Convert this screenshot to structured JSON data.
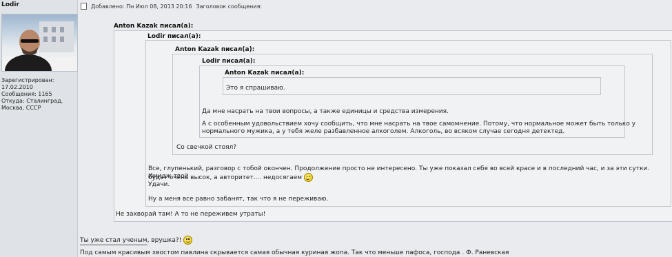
{
  "author": {
    "name": "Lodir",
    "profile_lines": [
      "Зарегистрирован:",
      "17.02.2010",
      "Сообщения: 1165",
      "Откуда: Сталинград,",
      "Москва, СССР"
    ]
  },
  "post": {
    "added": "Добавлено: Пн Июл 08, 2013 20:16",
    "subject_label": "Заголовок сообщения:"
  },
  "quotes": {
    "q1_head": "Anton Kazak писал(а):",
    "q2_head": "Lodir писал(а):",
    "q3_head": "Anton Kazak писал(а):",
    "q4_head": "Lodir писал(а):",
    "q5_head": "Anton Kazak писал(а):",
    "q5_text": "Это я спрашиваю.",
    "q4_text1": "Да мне насрать на твои вопросы, а также единицы и средства измерения.",
    "q4_text2a": "А с особенным удовольствием хочу сообщить, что мне насрать на твое самомнение. Потому, что нормальное может быть только у",
    "q4_text2b": "нормального мужика, а у тебя желе разбавленное алкоголем. Алкоголь, во всяком случае сегодня детектед.",
    "q3_text": "Со свечкой стоял?",
    "q2_text1a": "Все, глупенький, разговор с тобой окончен. Продолжение просто не интересено. Ты уже показал себя во всей красе и в последний час, и за эти сутки. Имидж твой",
    "q2_text1b": "будет очень высок, а авторитет.... недосягаем",
    "q2_text1c": "Удачи.",
    "q2_text2": "Ну а меня все равно забанят, так что я не переживаю.",
    "q1_text": "Не захворай там! А то не переживем утраты!"
  },
  "body": {
    "reply": "Ты уже стал ученым, врушка?!",
    "signature": "Под самым красивым хвостом павлина скрывается самая обычная куриная жопа. Так что меньше пафоса, господа . Ф. Раневская"
  },
  "icons": {
    "post": "post-icon",
    "smiley": "smiley-icon"
  }
}
